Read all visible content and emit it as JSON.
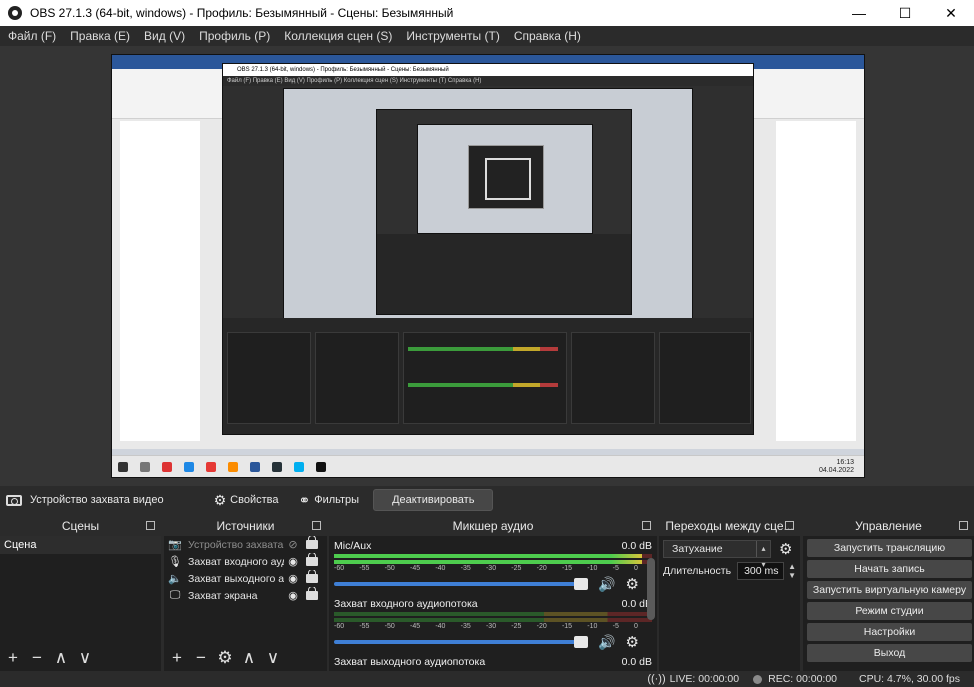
{
  "window": {
    "title": "OBS 27.1.3 (64-bit, windows) - Профиль: Безымянный - Сцены: Безымянный",
    "minimize": "—",
    "maximize": "☐",
    "close": "✕"
  },
  "menu": [
    "Файл (F)",
    "Правка (E)",
    "Вид (V)",
    "Профиль (P)",
    "Коллекция сцен (S)",
    "Инструменты (T)",
    "Справка (H)"
  ],
  "preview": {
    "nested_title": "OBS 27.1.3 (64-bit, windows) - Профиль: Безымянный - Сцены: Безымянный",
    "nested_menu": "Файл (F)   Правка (E)   Вид (V)   Профиль (P)   Коллекция сцен (S)   Инструменты (T)   Справка (H)",
    "taskbar_time": "16:13",
    "taskbar_date": "04.04.2022"
  },
  "source_toolbar": {
    "source_name": "Устройство захвата видео",
    "properties": "Свойства",
    "filters": "Фильтры",
    "deactivate": "Деактивировать"
  },
  "scenes": {
    "title": "Сцены",
    "items": [
      "Сцена"
    ],
    "footer": [
      "+",
      "−",
      "∧",
      "∨"
    ]
  },
  "sources": {
    "title": "Источники",
    "items": [
      {
        "name": "Устройство захвата ви",
        "icon": "camera-icon",
        "glyph": "📷",
        "dim": true
      },
      {
        "name": "Захват входного аудио",
        "icon": "microphone-icon",
        "glyph": "🎙",
        "dim": false
      },
      {
        "name": "Захват выходного ауд",
        "icon": "speaker-icon",
        "glyph": "🔈",
        "dim": false
      },
      {
        "name": "Захват экрана",
        "icon": "monitor-icon",
        "glyph": "🖵",
        "dim": false
      }
    ],
    "footer": [
      "+",
      "−",
      "⚙",
      "∧",
      "∨"
    ]
  },
  "mixer": {
    "title": "Микшер аудио",
    "scale": [
      "-60",
      "-55",
      "-50",
      "-45",
      "-40",
      "-35",
      "-30",
      "-25",
      "-20",
      "-15",
      "-10",
      "-5",
      "0"
    ],
    "channels": [
      {
        "name": "Mic/Aux",
        "db": "0.0 dB",
        "level": 0.97
      },
      {
        "name": "Захват входного аудиопотока",
        "db": "0.0 dB",
        "level": 0.0
      },
      {
        "name": "Захват выходного аудиопотока",
        "db": "0.0 dB",
        "level": 0.0
      }
    ]
  },
  "transitions": {
    "title": "Переходы между сце...",
    "selected": "Затухание",
    "duration_label": "Длительность",
    "duration_value": "300 ms"
  },
  "controls": {
    "title": "Управление",
    "buttons": [
      "Запустить трансляцию",
      "Начать запись",
      "Запустить виртуальную камеру",
      "Режим студии",
      "Настройки",
      "Выход"
    ]
  },
  "status": {
    "live": "LIVE: 00:00:00",
    "rec": "REC: 00:00:00",
    "cpu": "CPU: 4.7%, 30.00 fps"
  }
}
